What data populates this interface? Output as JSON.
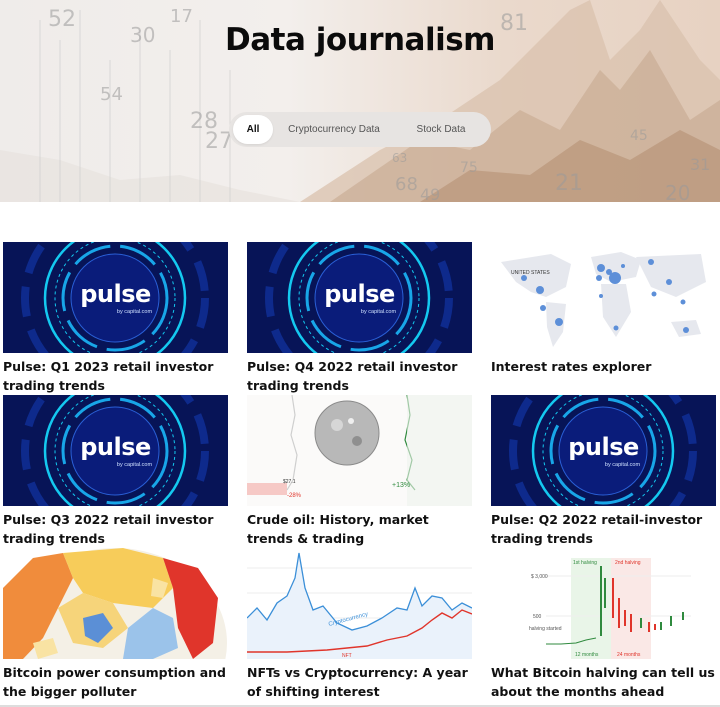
{
  "page": {
    "title": "Data journalism"
  },
  "filters": {
    "tabs": [
      {
        "label": "All",
        "active": true
      },
      {
        "label": "Cryptocurrency Data",
        "active": false
      },
      {
        "label": "Stock Data",
        "active": false
      }
    ]
  },
  "hero_numbers": [
    "52",
    "30",
    "17",
    "54",
    "81",
    "28",
    "27",
    "68",
    "75",
    "49",
    "63",
    "21",
    "20",
    "31",
    "45"
  ],
  "cards": [
    {
      "title": "Pulse: Q1 2023 retail investor trading trends",
      "thumb": "pulse-banner"
    },
    {
      "title": "Pulse: Q4 2022 retail investor trading trends",
      "thumb": "pulse-banner"
    },
    {
      "title": "Interest rates explorer",
      "thumb": "world-map"
    },
    {
      "title": "Pulse: Q3 2022 retail investor trading trends",
      "thumb": "pulse-banner"
    },
    {
      "title": "Crude oil: History, market trends & trading",
      "thumb": "oil-chart"
    },
    {
      "title": "Pulse: Q2 2022 retail-investor trading trends",
      "thumb": "pulse-banner"
    },
    {
      "title": "Bitcoin power consumption and the bigger polluter",
      "thumb": "energy-map"
    },
    {
      "title": "NFTs vs Cryptocurrency: A year of shifting interest",
      "thumb": "trend-lines"
    },
    {
      "title": "What Bitcoin halving can tell us about the months ahead",
      "thumb": "halving-chart"
    }
  ],
  "pulse": {
    "label": "pulse",
    "by": "by capital.com"
  },
  "map": {
    "label": "UNITED STATES"
  },
  "oil": {
    "price": "$27.1",
    "down": "-28%",
    "up": "+13%"
  },
  "trend": {
    "label": "Cryptocurrency",
    "nft": "NFT"
  },
  "halving": {
    "y1": "$ 3,000",
    "y2": "500",
    "mark1": "halving started",
    "tag1": "1st halving",
    "tag2": "2nd halving",
    "m1": "12 months",
    "m2": "24 months"
  },
  "colors": {
    "pulse_bg": "#071457",
    "pulse_ring": "#14c9f0",
    "accent_red": "#e0352b",
    "accent_green": "#2f8a3e",
    "trend_blue": "#3b8fd8"
  }
}
